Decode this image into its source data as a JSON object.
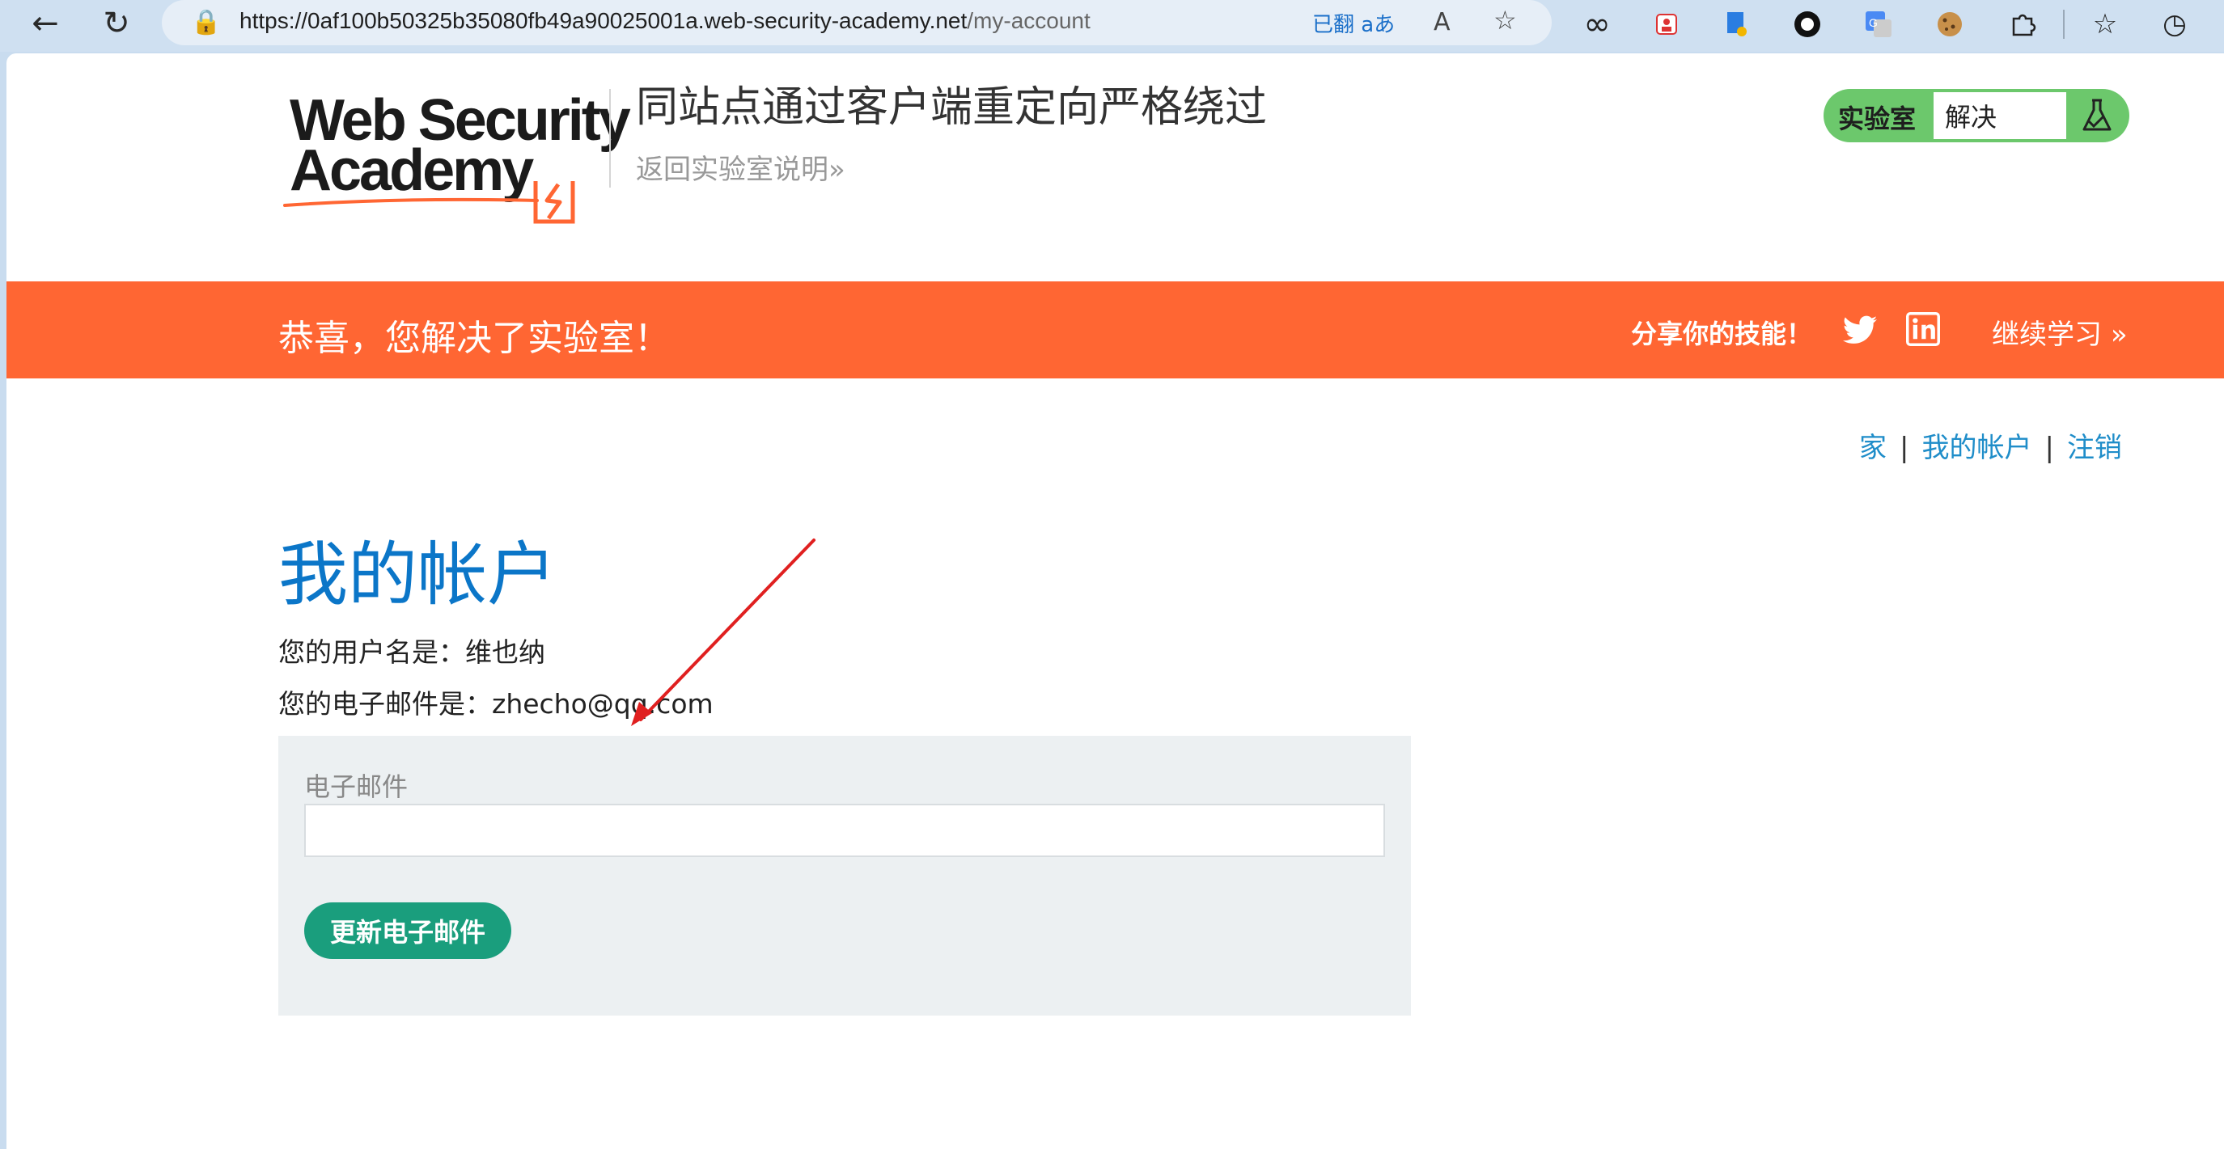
{
  "browser": {
    "url_base": "https://0af100b50325b35080fb49a90025001a.web-security-academy.net",
    "url_path": "/my-account",
    "translate_label": "已翻",
    "translate_aa": "aあ",
    "read_aloud": "A",
    "nav_icons": [
      "back-icon",
      "refresh-icon"
    ],
    "extension_icons": [
      "infinity-icon",
      "person-icon",
      "document-icon",
      "circle-icon",
      "translate-icon",
      "cookie-icon",
      "puzzle-icon",
      "favorites-icon",
      "history-icon"
    ]
  },
  "header": {
    "logo_line1": "Web Security",
    "logo_line2": "Academy",
    "lab_title": "同站点通过客户端重定向严格绕过",
    "back_link": "返回实验室说明",
    "badge_label": "实验室",
    "badge_status": "解决"
  },
  "success": {
    "message": "恭喜，您解决了实验室！",
    "share": "分享你的技能！",
    "continue": "继续学习"
  },
  "topnav": {
    "home": "家",
    "account": "我的帐户",
    "logout": "注销",
    "separator": "|"
  },
  "account": {
    "title": "我的帐户",
    "username_line": "您的用户名是：维也纳",
    "email_line": "您的电子邮件是：zhecho@qq.com",
    "email_label": "电子邮件",
    "email_value": "",
    "update_button": "更新电子邮件"
  },
  "colors": {
    "orange": "#ff6633",
    "green_badge": "#6cc86c",
    "title_blue": "#0b76c8",
    "link_blue": "#1f8dc9",
    "button_green": "#1a9e7d",
    "annotation_red": "#e02020"
  }
}
